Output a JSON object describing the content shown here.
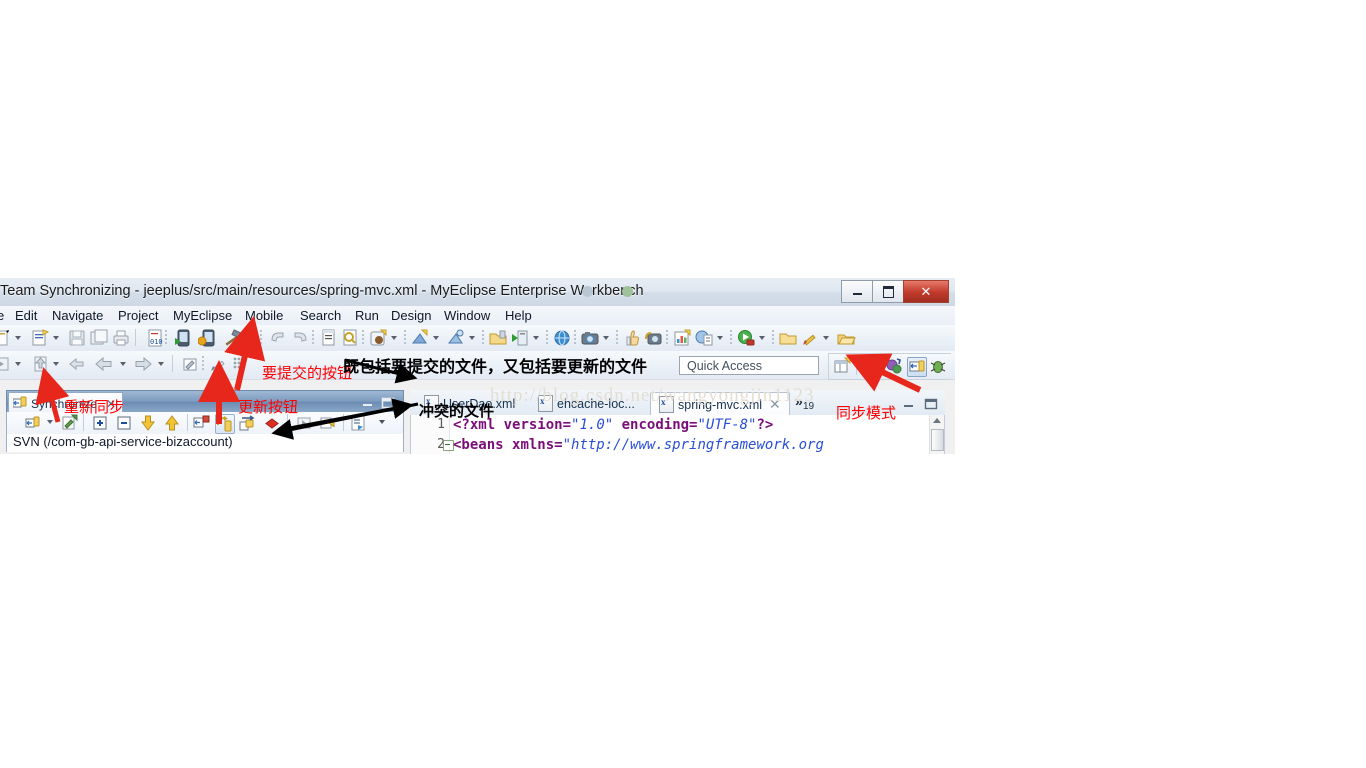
{
  "window": {
    "title": "Team Synchronizing - jeeplus/src/main/resources/spring-mvc.xml - MyEclipse Enterprise Workbench",
    "ghost_title": "· · ·",
    "buttons": {
      "minimize": "minimize-label",
      "maximize": "maximize-label",
      "close": "✕"
    }
  },
  "menubar": {
    "items": [
      {
        "label": "e"
      },
      {
        "label": "Edit"
      },
      {
        "label": "Navigate"
      },
      {
        "label": "Project"
      },
      {
        "label": "MyEclipse"
      },
      {
        "label": "Mobile"
      },
      {
        "label": "Search"
      },
      {
        "label": "Run"
      },
      {
        "label": "Design"
      },
      {
        "label": "Window"
      },
      {
        "label": "Help"
      }
    ]
  },
  "quick_access": {
    "placeholder": "Quick Access",
    "value": "Quick Access"
  },
  "sync_view": {
    "tab_label": "Synchronize",
    "close_glyph": "✕",
    "body_label": "SVN (/com-gb-api-service-bizaccount)"
  },
  "editor": {
    "tabs": [
      {
        "label": "UserDao.xml",
        "active": false
      },
      {
        "label": "ehcache-loc...",
        "active": false
      },
      {
        "label": "spring-mvc.xml",
        "active": true
      }
    ],
    "overflow_glyph": "»",
    "overflow_count": "19",
    "code": [
      {
        "num": "1",
        "text": "<?xml version=\"1.0\" encoding=\"UTF-8\"?>"
      },
      {
        "num": "2",
        "text": "<beans xmlns=\"http://www.springframework.org"
      }
    ]
  },
  "watermark": {
    "text": "http://blog.csdn.net/wangyongjin1123"
  },
  "annotations": [
    {
      "id": "submit-button",
      "text": "要提交的按钮",
      "color": "#ff0000"
    },
    {
      "id": "update-button",
      "text": "更新按钮",
      "color": "#ff0000"
    },
    {
      "id": "resync",
      "text": "重新同步",
      "color": "#ff0000"
    },
    {
      "id": "sync-mode",
      "text": "同步模式",
      "color": "#ff0000"
    },
    {
      "id": "includes-files",
      "text": "既包括要提交的文件，又包括要更新的文件",
      "color": "#000000"
    },
    {
      "id": "conflict-files",
      "text": "冲突的文件",
      "color": "#000000"
    }
  ],
  "colors": {
    "accent_red": "#ff0000",
    "arrow_red": "#e8271c",
    "arrow_black": "#000000",
    "title_bg": "#dfe7f1",
    "toolbar_bg": "#eaf0f7",
    "view_tab_bg": "#7e9cc0"
  }
}
